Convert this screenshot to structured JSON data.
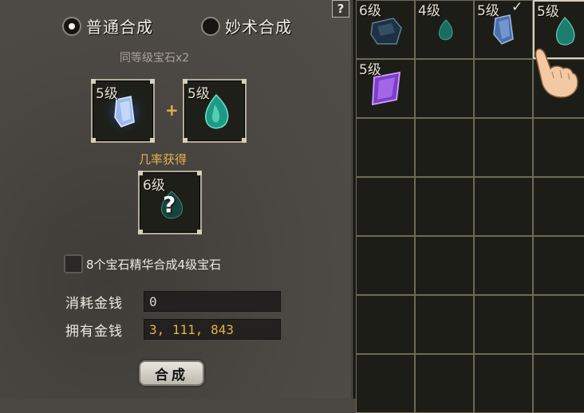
{
  "help_button": "?",
  "modes": [
    {
      "label": "普通合成",
      "selected": true
    },
    {
      "label": "妙术合成",
      "selected": false
    }
  ],
  "requirement": "同等级宝石x2",
  "inputs": [
    {
      "level": "5级",
      "gem": "blue-crystal"
    },
    {
      "level": "5级",
      "gem": "teal-droplet"
    }
  ],
  "plus": "+",
  "chance_label": "几率获得",
  "output": {
    "level": "6级",
    "gem": "unknown",
    "symbol": "?"
  },
  "essence_option": {
    "label": "8个宝石精华合成4级宝石",
    "checked": false
  },
  "cost": {
    "label": "消耗金钱",
    "value": "0"
  },
  "owned": {
    "label": "拥有金钱",
    "value": "3, 111, 843"
  },
  "synthesize_button": "合成",
  "inventory": [
    {
      "level": "6级",
      "gem": "dark-blue",
      "mark": ""
    },
    {
      "level": "4级",
      "gem": "teal-small",
      "mark": ""
    },
    {
      "level": "5级",
      "gem": "blue-crystal",
      "mark": "✓"
    },
    {
      "level": "5级",
      "gem": "teal-droplet",
      "mark": ""
    },
    {
      "level": "5级",
      "gem": "purple-crystal",
      "mark": ""
    }
  ],
  "colors": {
    "gold": "#e6b13e",
    "chance": "#e2b34c",
    "grid_line": "#6c6a55"
  }
}
